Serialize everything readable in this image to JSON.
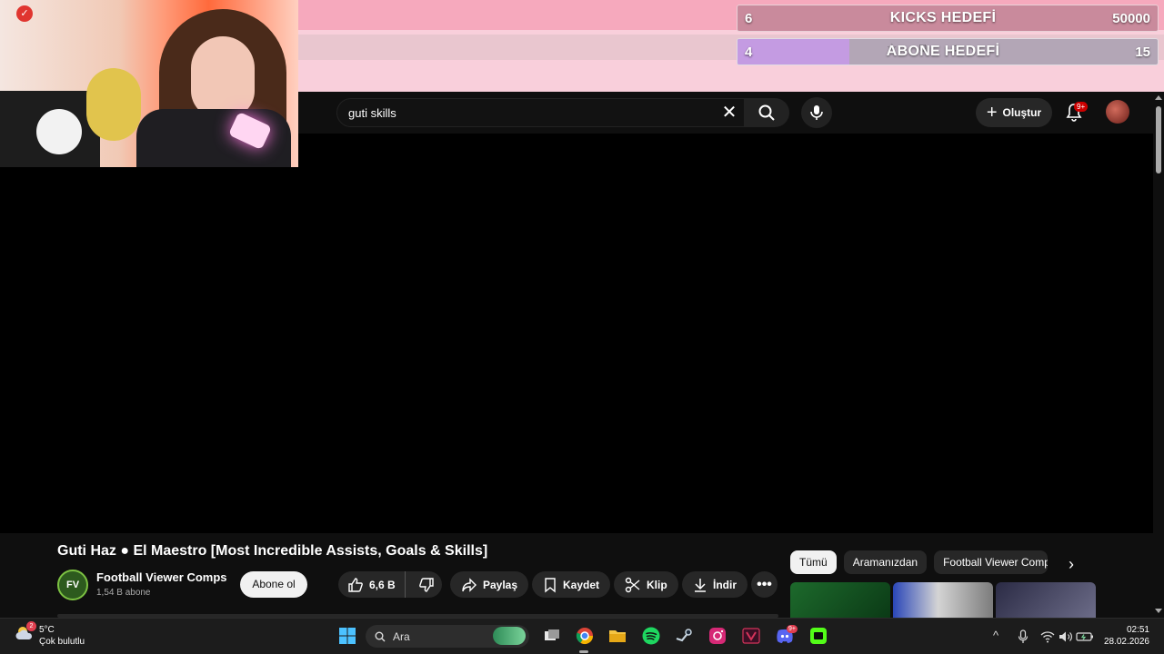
{
  "overlay": {
    "kicks_goal": {
      "current": "6",
      "label": "KICKS HEDEFİ",
      "target": "50000",
      "progress": 0.0001
    },
    "sub_goal": {
      "current": "4",
      "label": "ABONE HEDEFİ",
      "target": "15",
      "progress": 0.267
    }
  },
  "youtube": {
    "search": {
      "value": "guti skills"
    },
    "header": {
      "create_label": "Oluştur",
      "notification_badge": "9+"
    },
    "video": {
      "title": "Guti Haz ● El Maestro [Most Incredible Assists, Goals & Skills]",
      "channel_logo_text": "FV",
      "channel_name": "Football Viewer Comps",
      "channel_subs": "1,54 B abone",
      "subscribe_label": "Abone ol",
      "like_count": "6,6 B",
      "share_label": "Paylaş",
      "save_label": "Kaydet",
      "clip_label": "Klip",
      "download_label": "İndir",
      "more_label": "•••"
    },
    "chips": [
      "Tümü",
      "Aramanızdan",
      "Football Viewer Comps"
    ],
    "chip_next": "›"
  },
  "taskbar": {
    "weather_temp": "5°C",
    "weather_desc": "Çok bulutlu",
    "weather_badge": "2",
    "search_placeholder": "Ara",
    "discord_badge": "9+",
    "time": "02:51",
    "date": "28.02.2026"
  },
  "colors": {
    "kicks_bar": "#c98a9c",
    "sub_bar_fill": "#c49be2",
    "youtube_bg": "#0f0f0f",
    "chip_active": "#f1f1f1"
  }
}
